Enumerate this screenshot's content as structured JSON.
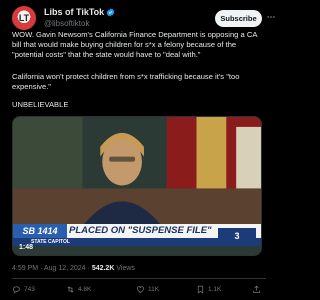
{
  "account": {
    "display_name": "Libs of TikTok",
    "handle": "@libsoftiktok",
    "avatar_text": "LT",
    "verified_color": "#1d9bf0"
  },
  "subscribe_label": "Subscribe",
  "tweet": {
    "paragraph_1": "WOW. Gavin Newsom's California Finance Department is opposing a CA bill that would make buying children for s*x a felony because of the \"potential costs\" that the state would have to \"deal with.\"",
    "paragraph_2": "California won't protect children from s*x trafficking because it's \"too expensive.\"",
    "paragraph_3": "UNBELIEVABLE"
  },
  "video": {
    "bill_tag": "SB 1414",
    "headline": "PLACED ON \"SUSPENSE FILE\"",
    "subline": "STATE CAPITOL",
    "station": "3",
    "elapsed": "1:48",
    "progress_fraction": 0.05
  },
  "meta": {
    "time": "4:59 PM",
    "date": "Aug 12, 2024",
    "views": "542.2K",
    "views_label": "Views"
  },
  "actions": {
    "replies": "743",
    "reposts": "4.8K",
    "likes": "11K",
    "bookmarks": "1.1K"
  },
  "colors": {
    "background": "#000000",
    "text": "#e7e9ea",
    "muted": "#71767b",
    "accent": "#1d9bf0"
  }
}
